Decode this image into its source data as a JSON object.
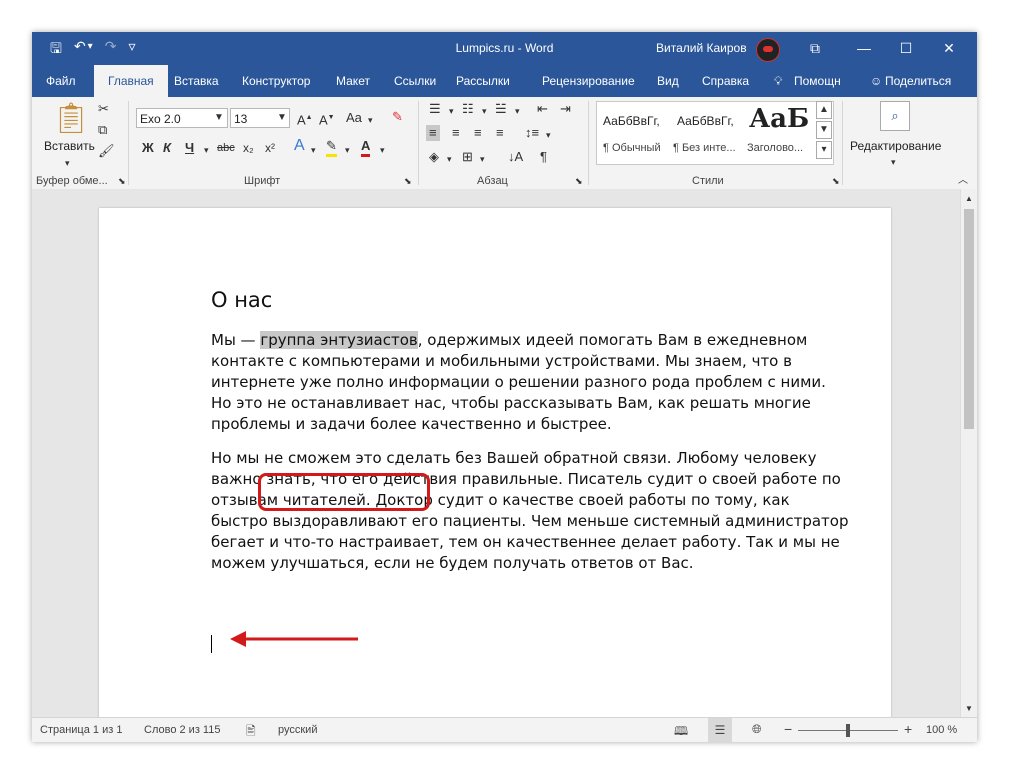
{
  "window": {
    "title": "Lumpics.ru  -  Word",
    "user": "Виталий Каиров",
    "controls": {
      "restore_ribbon": "⧉",
      "minimize": "—",
      "maximize": "☐",
      "close": "✕"
    }
  },
  "qat": {
    "save_icon": "🖫",
    "undo_icon": "↶",
    "undo_drop": "▾",
    "redo_icon": "↷",
    "customize_icon": "▿"
  },
  "tabs": [
    {
      "label": "Файл"
    },
    {
      "label": "Главная"
    },
    {
      "label": "Вставка"
    },
    {
      "label": "Конструктор"
    },
    {
      "label": "Макет"
    },
    {
      "label": "Ссылки"
    },
    {
      "label": "Рассылки"
    },
    {
      "label": "Рецензирование"
    },
    {
      "label": "Вид"
    },
    {
      "label": "Справка"
    },
    {
      "label": "Помощн"
    },
    {
      "label": "Поделиться"
    }
  ],
  "ribbon": {
    "clipboard": {
      "label": "Буфер обме...",
      "paste": "Вставить"
    },
    "font": {
      "label": "Шрифт",
      "name": "Exo 2.0",
      "size": "13",
      "bold": "Ж",
      "italic": "К",
      "underline": "Ч",
      "strike": "abc",
      "sub": "x₂",
      "sup": "x²",
      "case": "Aa"
    },
    "paragraph": {
      "label": "Абзац",
      "pilcrow": "¶"
    },
    "styles": {
      "label": "Стили",
      "items": [
        {
          "preview": "АаБбВвГг,",
          "name": "¶ Обычный"
        },
        {
          "preview": "АаБбВвГг,",
          "name": "¶ Без инте..."
        },
        {
          "preview": "АаБ",
          "name": "Заголово..."
        }
      ]
    },
    "editing": {
      "label": "Редактирование"
    }
  },
  "document": {
    "title": "О нас",
    "p1": {
      "before": "Мы — ",
      "highlight": "группа энтузиастов",
      "after": ", одержимых идеей помогать Вам в ежедневном контакте с компьютерами и мобильными устройствами. Мы знаем, что в интернете уже полно информации о решении разного рода проблем с ними. Но это не останавливает нас, чтобы рассказывать Вам, как решать многие проблемы и задачи более качественно и быстрее."
    },
    "p2": "Но мы не сможем это сделать без Вашей обратной связи. Любому человеку важно знать, что его действия правильные. Писатель судит о своей работе по отзывам читателей. Доктор судит о качестве своей работы по тому, как быстро выздоравливают его пациенты. Чем меньше системный администратор бегает и что-то настраивает, тем он качественнее делает работу. Так и мы не можем улучшаться, если не будем получать ответов от Вас."
  },
  "status": {
    "page": "Страница 1 из 1",
    "words": "Слово 2 из 115",
    "language": "русский",
    "zoom_minus": "−",
    "zoom_plus": "+",
    "zoom": "100 %",
    "zoom_level_fraction": 0.5
  },
  "colors": {
    "brand": "#2b579a",
    "callout": "#d21a1a",
    "highlight": "#c8c8c8"
  }
}
